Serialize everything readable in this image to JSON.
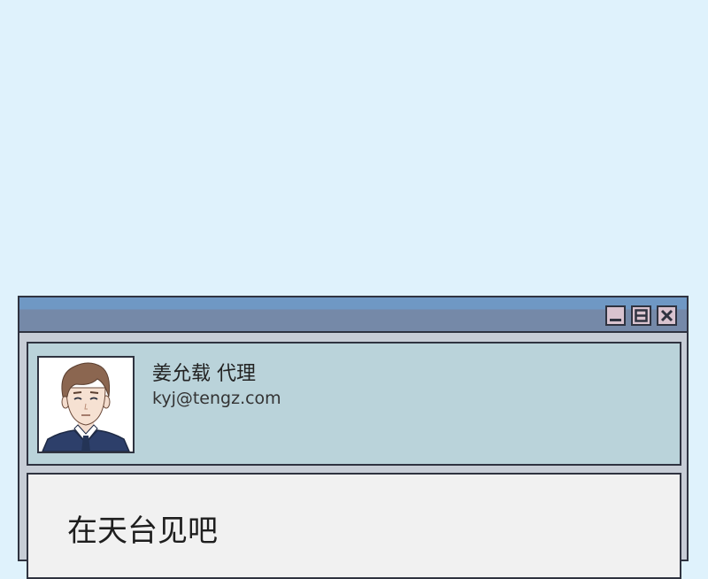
{
  "window": {
    "controls": {
      "minimize_icon": "minimize-icon",
      "maximize_icon": "maximize-icon",
      "close_icon": "close-icon"
    }
  },
  "sender": {
    "name": "姜允载 代理",
    "email": "kyj@tengz.com",
    "avatar_icon": "avatar-portrait"
  },
  "message": {
    "text": "在天台见吧"
  },
  "colors": {
    "background": "#dff2fc",
    "titlebar_top": "#6f98c4",
    "titlebar_bottom": "#7589a8",
    "header_panel": "#bad3da",
    "body_panel": "#f1f1f1",
    "window_button": "#d9c3cf",
    "border": "#2f3340"
  }
}
